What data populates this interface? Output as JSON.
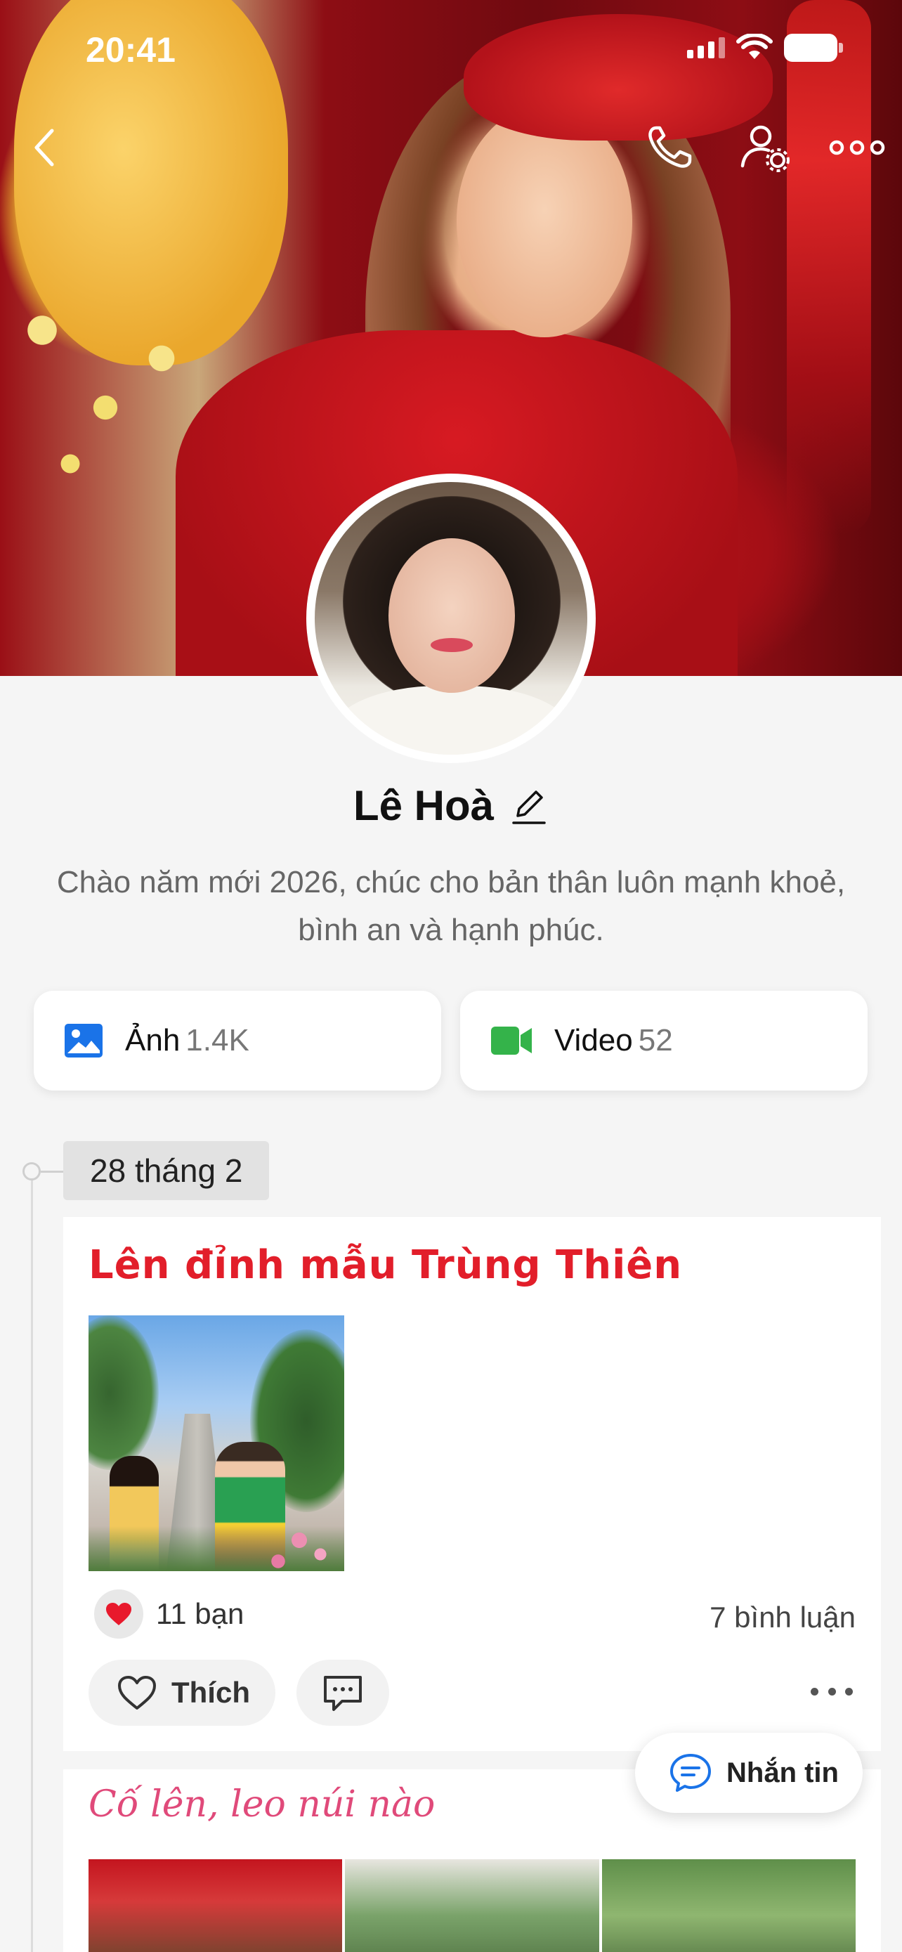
{
  "status_bar": {
    "time": "20:41"
  },
  "colors": {
    "accent_blue": "#1a73e8",
    "video_green": "#34b34a",
    "post_title_red": "#e21e2a",
    "post_title_pink": "#e04a7a",
    "heart_red": "#e8192c"
  },
  "nav": {
    "back_icon": "chevron-left-icon",
    "call_icon": "phone-icon",
    "settings_icon": "user-gear-icon",
    "more_icon": "more-horizontal-icon"
  },
  "profile": {
    "name": "Lê Hoà",
    "bio": "Chào năm mới 2026, chúc cho bản thân luôn mạnh khoẻ, bình an và hạnh phúc."
  },
  "media": {
    "photos": {
      "label": "Ảnh",
      "count": "1.4K"
    },
    "videos": {
      "label": "Video",
      "count": "52"
    }
  },
  "timeline": {
    "date": "28 tháng 2",
    "posts": [
      {
        "title": "Lên đỉnh mẫu Trùng Thiên",
        "reaction_text": "11 bạn",
        "comments_text": "7 bình luận",
        "like_label": "Thích"
      },
      {
        "title": "Cố lên, leo núi nào"
      }
    ]
  },
  "floating": {
    "message_label": "Nhắn tin"
  }
}
